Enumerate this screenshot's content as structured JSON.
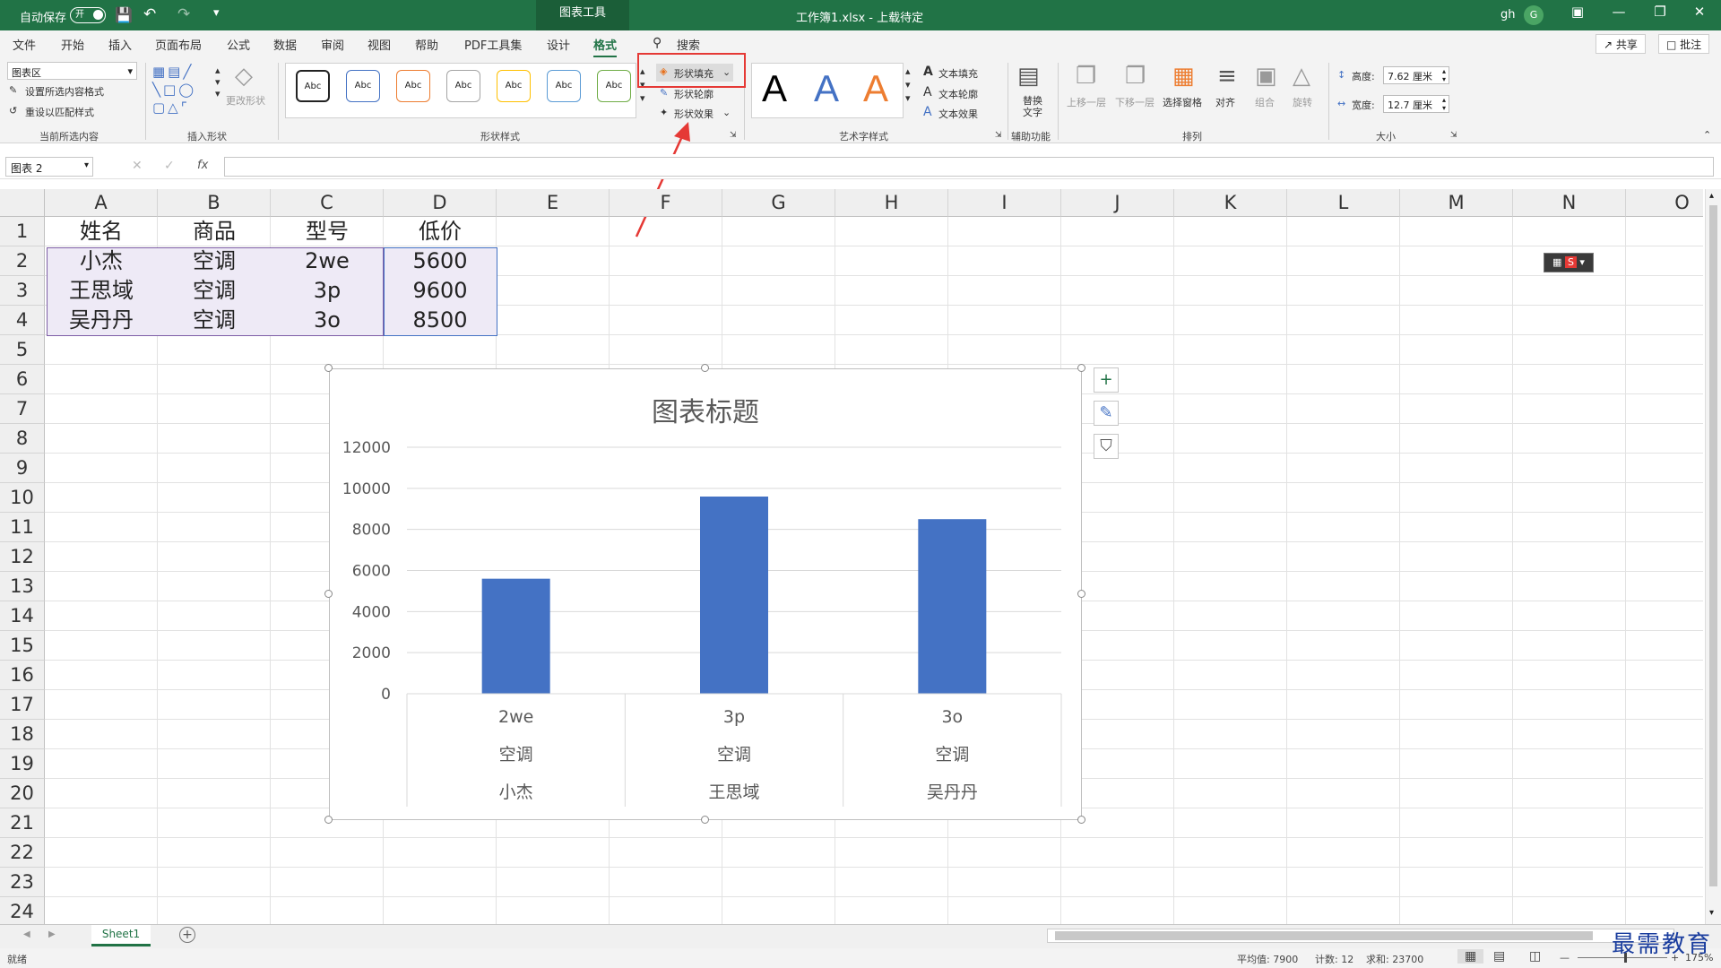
{
  "titlebar": {
    "autosave_label": "自动保存",
    "autosave_state": "开",
    "context_tab": "图表工具",
    "document_title": "工作簿1.xlsx - 上载待定",
    "user_initials": "gh",
    "avatar_letter": "G"
  },
  "menu": {
    "tabs": [
      "文件",
      "开始",
      "插入",
      "页面布局",
      "公式",
      "数据",
      "审阅",
      "视图",
      "帮助",
      "PDF工具集",
      "设计",
      "格式"
    ],
    "active_tab": "格式",
    "search_label": "搜索",
    "share_label": "共享",
    "comment_label": "批注"
  },
  "ribbon": {
    "current_selection": {
      "dropdown_value": "图表区",
      "format_selection": "设置所选内容格式",
      "reset_style": "重设以匹配样式",
      "label": "当前所选内容"
    },
    "insert_shapes": {
      "change_shape": "更改形状",
      "label": "插入形状"
    },
    "shape_styles": {
      "swatch_text": "Abc",
      "swatch_colors": [
        "#222222",
        "#4472c4",
        "#ed7d31",
        "#a5a5a5",
        "#ffc000",
        "#5b9bd5",
        "#70ad47"
      ],
      "fill": "形状填充",
      "outline": "形状轮廓",
      "effects": "形状效果",
      "label": "形状样式"
    },
    "wordart": {
      "letter": "A",
      "colors": [
        "#000000",
        "#4472c4",
        "#ed7d31"
      ],
      "text_fill": "文本填充",
      "text_outline": "文本轮廓",
      "text_effects": "文本效果",
      "label": "艺术字样式"
    },
    "accessibility": {
      "alt_text": "替换文字",
      "label": "辅助功能"
    },
    "arrange": {
      "bring_forward": "上移一层",
      "send_backward": "下移一层",
      "selection_pane": "选择窗格",
      "align": "对齐",
      "group": "组合",
      "rotate": "旋转",
      "label": "排列"
    },
    "size": {
      "height_label": "高度:",
      "height_value": "7.62 厘米",
      "width_label": "宽度:",
      "width_value": "12.7 厘米",
      "label": "大小"
    }
  },
  "formula_bar": {
    "name_box": "图表 2",
    "fx": "fx",
    "content": ""
  },
  "columns": [
    "A",
    "B",
    "C",
    "D",
    "E",
    "F",
    "G",
    "H",
    "I",
    "J",
    "K",
    "L",
    "M",
    "N",
    "O"
  ],
  "rows": [
    "1",
    "2",
    "3",
    "4",
    "5",
    "6",
    "7",
    "8",
    "9",
    "10",
    "11",
    "12",
    "13",
    "14",
    "15",
    "16",
    "17",
    "18",
    "19",
    "20",
    "21",
    "22",
    "23",
    "24"
  ],
  "table": [
    [
      "姓名",
      "商品",
      "型号",
      "低价"
    ],
    [
      "小杰",
      "空调",
      "2we",
      "5600"
    ],
    [
      "王思域",
      "空调",
      "3p",
      "9600"
    ],
    [
      "吴丹丹",
      "空调",
      "3o",
      "8500"
    ]
  ],
  "chart_data": {
    "type": "bar",
    "title": "图表标题",
    "categories": [
      [
        "2we",
        "空调",
        "小杰"
      ],
      [
        "3p",
        "空调",
        "王思域"
      ],
      [
        "3o",
        "空调",
        "吴丹丹"
      ]
    ],
    "values": [
      5600,
      9600,
      8500
    ],
    "ylim": [
      0,
      12000
    ],
    "yticks": [
      "0",
      "2000",
      "4000",
      "6000",
      "8000",
      "10000",
      "12000"
    ],
    "grid": true,
    "bar_color": "#4472c4"
  },
  "chart_buttons": {
    "add": "+",
    "style": "✎",
    "filter": "⛉"
  },
  "sheets": {
    "tabs": [
      "Sheet1"
    ],
    "add": "+"
  },
  "status": {
    "ready": "就绪",
    "average": "平均值: 7900",
    "count": "计数: 12",
    "sum": "求和: 23700",
    "zoom": "175%"
  },
  "watermark": "最需教育",
  "colors": {
    "excel_green": "#217346",
    "highlight_red": "#e53935"
  }
}
